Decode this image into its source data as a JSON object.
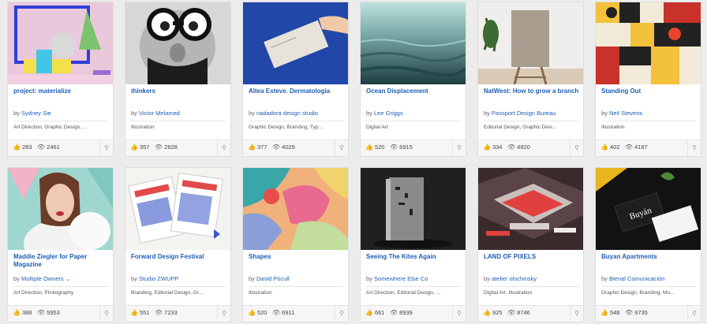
{
  "projects": [
    {
      "title": "project: materialize",
      "owner": "Sydney Sie",
      "fields": "Art Direction, Graphic Design, ...",
      "likes": "283",
      "views": "2461"
    },
    {
      "title": "thinkers",
      "owner": "Victor Melamed",
      "fields": "Illustration",
      "likes": "357",
      "views": "2828"
    },
    {
      "title": "Altea Esteve. Dermatologia",
      "owner": "nadadora design studio",
      "fields": "Graphic Design, Branding, Typ...",
      "likes": "377",
      "views": "4029"
    },
    {
      "title": "Ocean Displacement",
      "owner": "Lee Griggs",
      "fields": "Digital Art",
      "likes": "520",
      "views": "6915"
    },
    {
      "title": "NatWest: How to grow a branch",
      "owner": "Passport Design Bureau",
      "fields": "Editorial Design, Graphic Desi...",
      "likes": "334",
      "views": "4820"
    },
    {
      "title": "Standing Out",
      "owner": "Neil Stevens",
      "fields": "Illustration",
      "likes": "402",
      "views": "4187"
    },
    {
      "title": "Maddie Ziegler for Paper Magazine",
      "owner": "Multiple Owners",
      "owner_chevron": "⌄",
      "fields": "Art Direction, Photography",
      "likes": "388",
      "views": "5953"
    },
    {
      "title": "Forward Design Festival",
      "owner": "Studio ZWUPP",
      "fields": "Branding, Editorial Design, Gr...",
      "likes": "551",
      "views": "7233"
    },
    {
      "title": "Shapes",
      "owner": "David Pocull",
      "fields": "Illustration",
      "likes": "520",
      "views": "6911"
    },
    {
      "title": "Seeing The Kites Again",
      "owner": "Somewhere Else Co",
      "fields": "Art Direction, Editorial Design, ...",
      "likes": "661",
      "views": "8939"
    },
    {
      "title": "LAND OF PIXELS",
      "owner": "atelier olschinsky",
      "fields": "Digital Art, Illustration",
      "likes": "925",
      "views": "8746"
    },
    {
      "title": "Buyan Apartments",
      "owner": "Bienal Comunicación",
      "fields": "Graphic Design, Branding, Mo...",
      "likes": "548",
      "views": "9735"
    }
  ],
  "by_label": "by",
  "icons": {
    "like": "thumbs-up-icon",
    "view": "eye-icon",
    "save": "pin-icon"
  },
  "colors": {
    "link": "#1f5fb5",
    "background": "#ececec"
  }
}
